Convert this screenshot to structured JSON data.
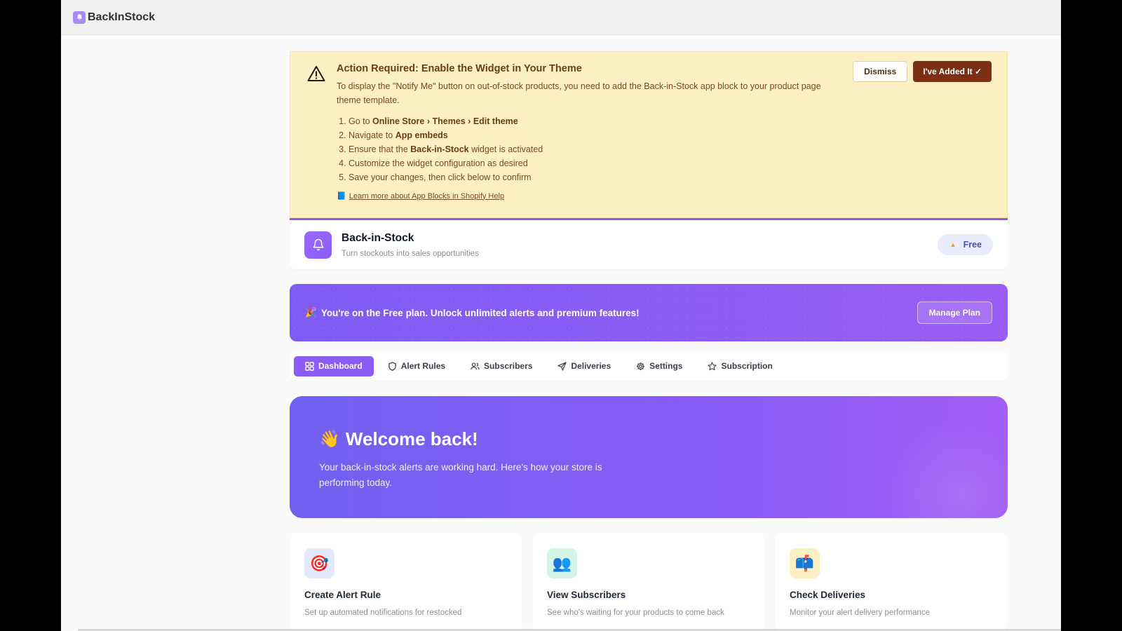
{
  "app": {
    "logo_text": "BackInStock"
  },
  "alert": {
    "title": "Action Required: Enable the Widget in Your Theme",
    "description": "To display the \"Notify Me\" button on out-of-stock products, you need to add the Back-in-Stock app block to your product page theme template.",
    "steps": [
      {
        "prefix": "Go to ",
        "bold": "Online Store › Themes › Edit theme",
        "suffix": ""
      },
      {
        "prefix": "Navigate to ",
        "bold": "App embeds",
        "suffix": ""
      },
      {
        "prefix": "Ensure that the ",
        "bold": "Back-in-Stock",
        "suffix": " widget is activated"
      },
      {
        "prefix": "Customize the widget configuration as desired",
        "bold": "",
        "suffix": ""
      },
      {
        "prefix": "Save your changes, then click below to confirm",
        "bold": "",
        "suffix": ""
      }
    ],
    "link_text": "Learn more about App Blocks in Shopify Help",
    "dismiss_label": "Dismiss",
    "confirm_label": "I've Added It ✓"
  },
  "header": {
    "title": "Back-in-Stock",
    "subtitle": "Turn stockouts into sales opportunities",
    "plan_label": "Free"
  },
  "promo": {
    "prefix": "You're on the ",
    "plan": "Free",
    "suffix": " plan. Unlock unlimited alerts and premium features!",
    "button_label": "Manage Plan"
  },
  "tabs": [
    {
      "label": "Dashboard",
      "icon": "grid-icon",
      "active": true
    },
    {
      "label": "Alert Rules",
      "icon": "shield-icon",
      "active": false
    },
    {
      "label": "Subscribers",
      "icon": "users-icon",
      "active": false
    },
    {
      "label": "Deliveries",
      "icon": "send-icon",
      "active": false
    },
    {
      "label": "Settings",
      "icon": "gear-icon",
      "active": false
    },
    {
      "label": "Subscription",
      "icon": "star-icon",
      "active": false
    }
  ],
  "welcome": {
    "title": "Welcome back!",
    "subtitle": "Your back-in-stock alerts are working hard. Here's how your store is performing today."
  },
  "cards": [
    {
      "title": "Create Alert Rule",
      "description": "Set up automated notifications for restocked",
      "icon": "target-icon"
    },
    {
      "title": "View Subscribers",
      "description": "See who's waiting for your products to come back",
      "icon": "people-icon"
    },
    {
      "title": "Check Deliveries",
      "description": "Monitor your alert delivery performance",
      "icon": "mailbox-icon"
    }
  ]
}
